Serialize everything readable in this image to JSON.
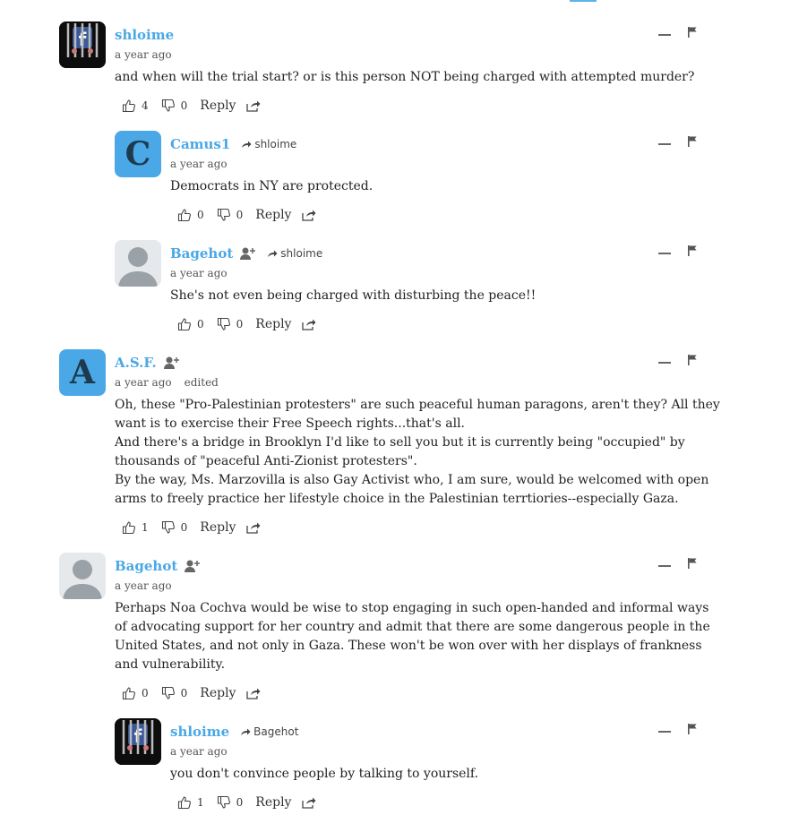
{
  "labels": {
    "reply": "Reply",
    "edited": "edited"
  },
  "comments": [
    {
      "author": "shloime",
      "time": "a year ago",
      "text": [
        "and when will the trial start? or is this person NOT being charged with attempted murder?"
      ],
      "likes": "4",
      "dislikes": "0",
      "avatar_icon": "facebook-jail-avatar",
      "avatar_caption": "Facebook Jail"
    },
    {
      "author": "Camus1",
      "reply_to": "shloime",
      "time": "a year ago",
      "text": [
        "Democrats in NY are protected."
      ],
      "likes": "0",
      "dislikes": "0",
      "avatar_letter": "C",
      "avatar_color": "#4aa8e6"
    },
    {
      "author": "Bagehot",
      "reply_to": "shloime",
      "time": "a year ago",
      "text": [
        "She's not even being charged with disturbing the peace!!"
      ],
      "likes": "0",
      "dislikes": "0",
      "avatar_icon": "default-user-avatar"
    },
    {
      "author": "A.S.F.",
      "time": "a year ago",
      "edited": "edited",
      "text": [
        "Oh, these \"Pro-Palestinian protesters\" are such peaceful human paragons, aren't they? All they want is to exercise their Free Speech rights...that's all.",
        "And there's a bridge in Brooklyn I'd like to sell you but it is currently being \"occupied\" by thousands of \"peaceful Anti-Zionist protesters\".",
        "By the way, Ms. Marzovilla is also Gay Activist who, I am sure, would be welcomed with open arms to freely practice her lifestyle choice in the Palestinian terrtiories--especially Gaza."
      ],
      "likes": "1",
      "dislikes": "0",
      "avatar_letter": "A",
      "avatar_color": "#4aa8e6"
    },
    {
      "author": "Bagehot",
      "time": "a year ago",
      "text": [
        "Perhaps Noa Cochva would be wise to stop engaging in such open-handed and informal ways of advocating support for her country and admit that there are some dangerous people in the United States, and not only in Gaza. These won't be won over with her displays of frankness and vulnerability."
      ],
      "likes": "0",
      "dislikes": "0",
      "avatar_icon": "default-user-avatar"
    },
    {
      "author": "shloime",
      "reply_to": "Bagehot",
      "time": "a year ago",
      "text": [
        "you don't convince people by talking to yourself."
      ],
      "likes": "1",
      "dislikes": "0",
      "avatar_icon": "facebook-jail-avatar",
      "avatar_caption": "Facebook Jail"
    }
  ]
}
